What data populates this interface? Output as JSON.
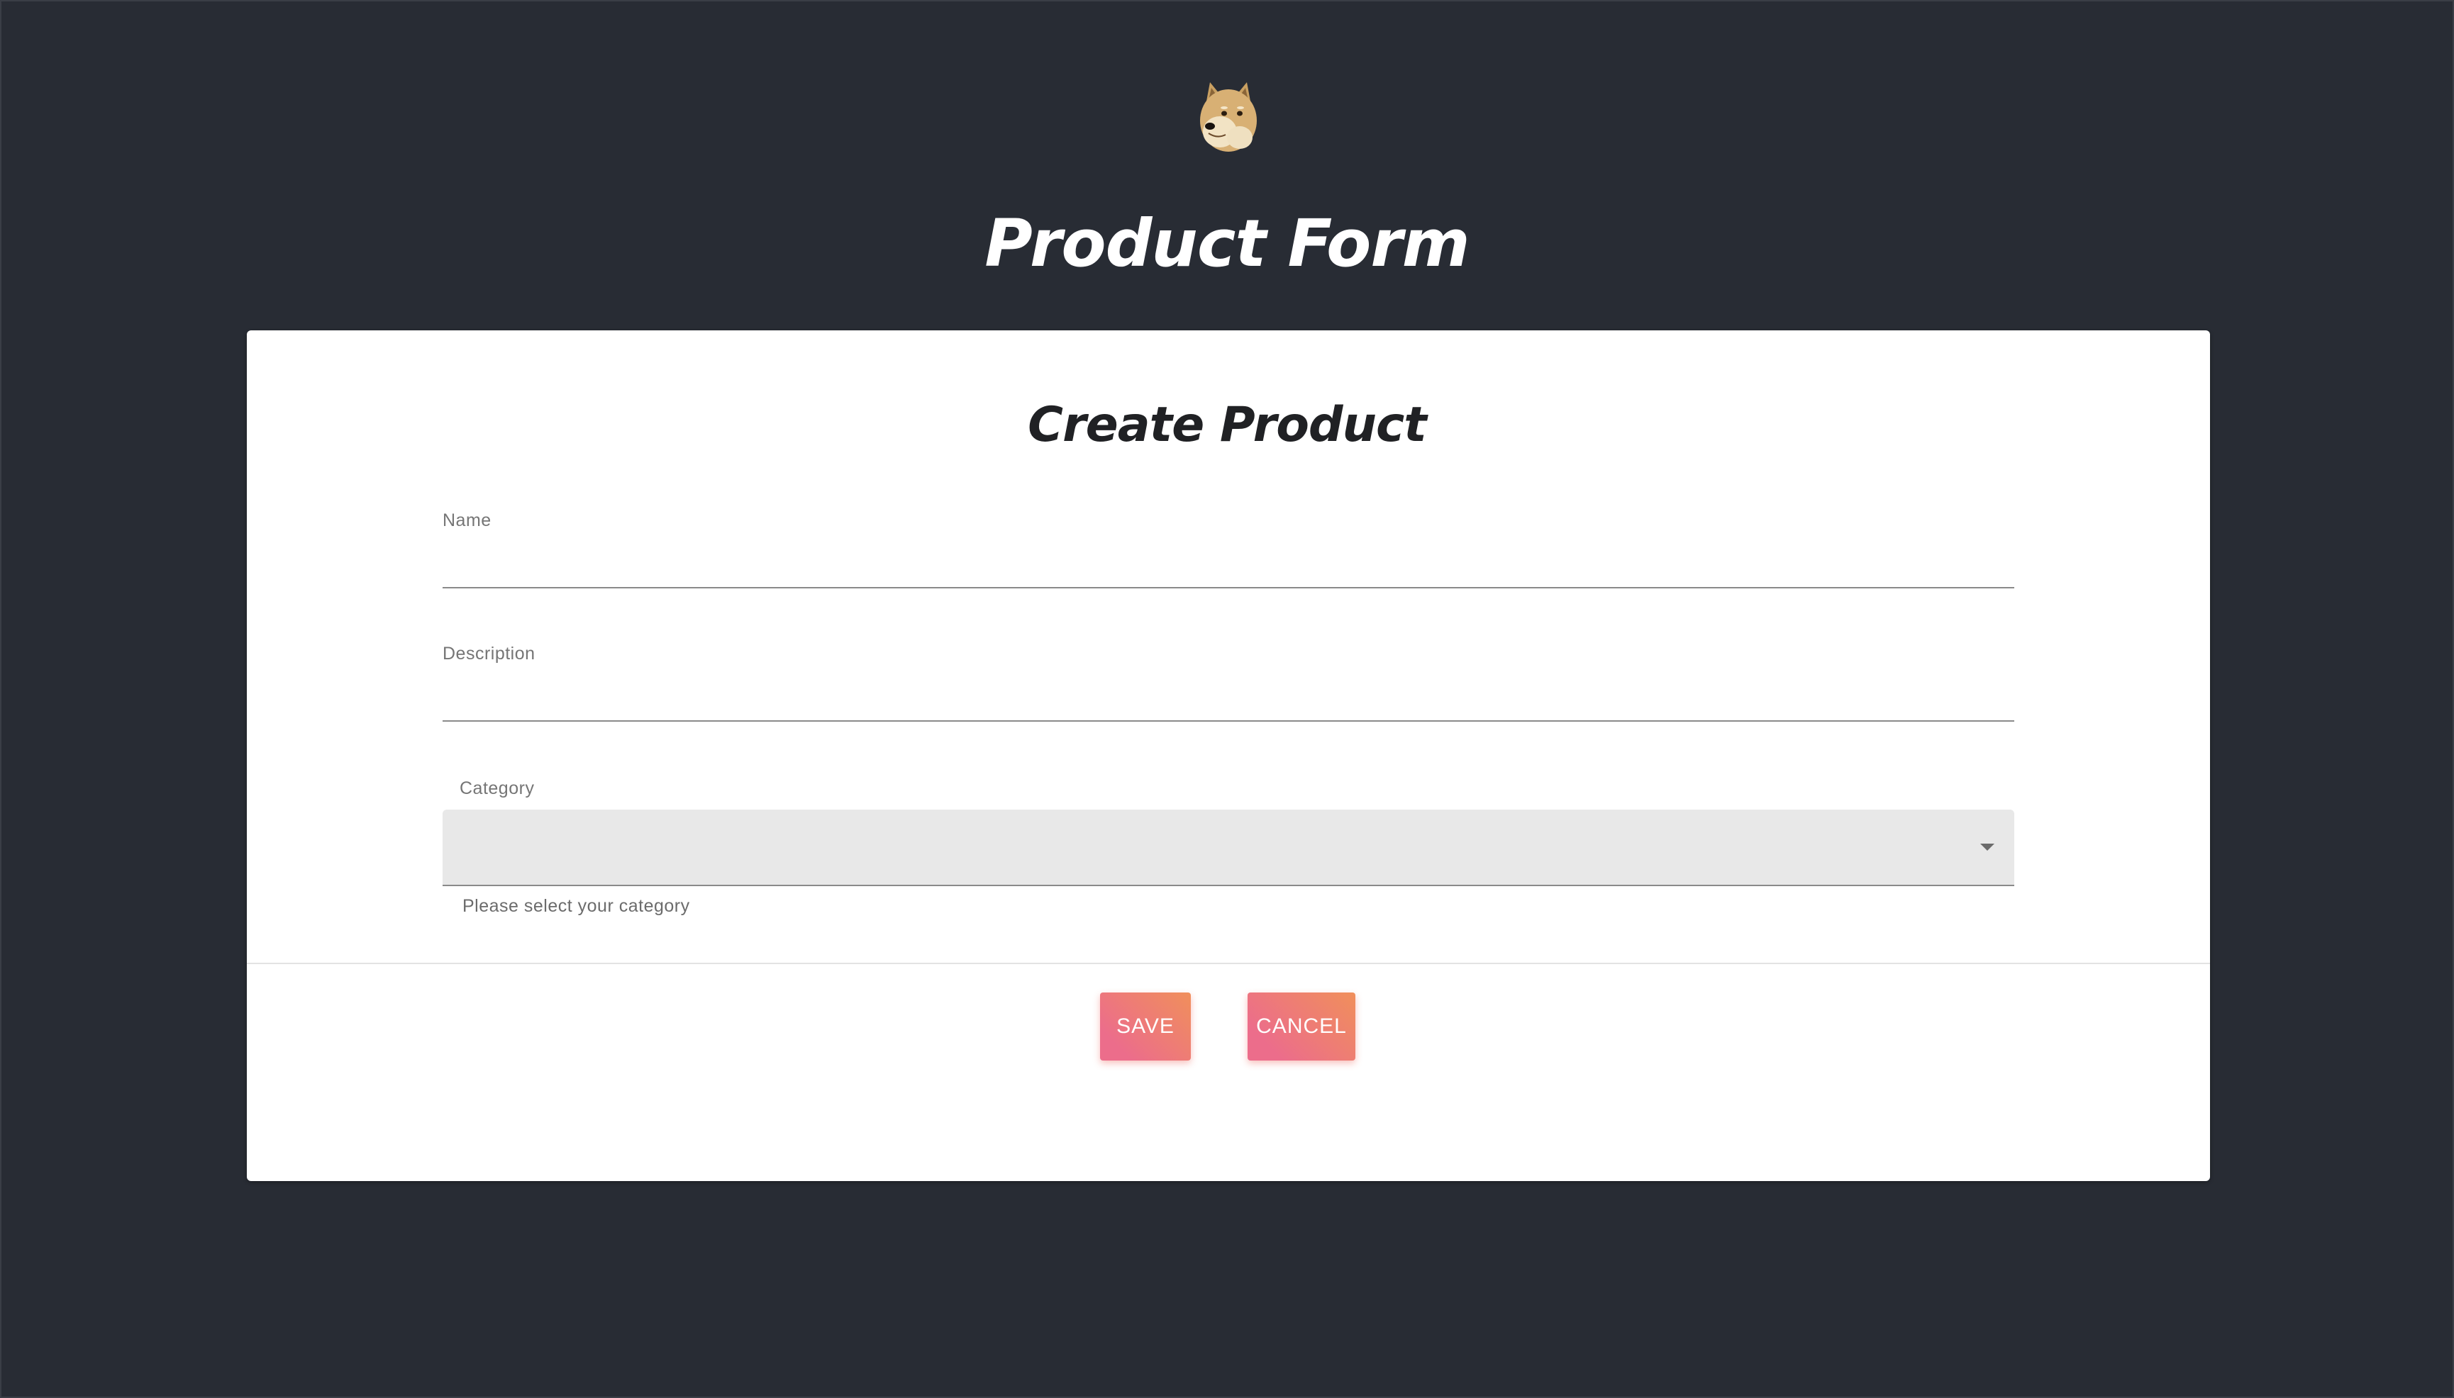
{
  "header": {
    "logo_icon": "doge-logo-icon",
    "title": "Product Form"
  },
  "card": {
    "title": "Create Product",
    "fields": {
      "name": {
        "label": "Name",
        "value": ""
      },
      "description": {
        "label": "Description",
        "value": ""
      },
      "category": {
        "label": "Category",
        "selected": "",
        "helper": "Please select your category",
        "icon": "chevron-down-icon"
      }
    },
    "actions": {
      "save_label": "SAVE",
      "cancel_label": "CANCEL"
    }
  },
  "colors": {
    "background": "#282c34",
    "card": "#ffffff",
    "button_gradient_start": "#ec6d8b",
    "button_gradient_end": "#f08f5b"
  }
}
